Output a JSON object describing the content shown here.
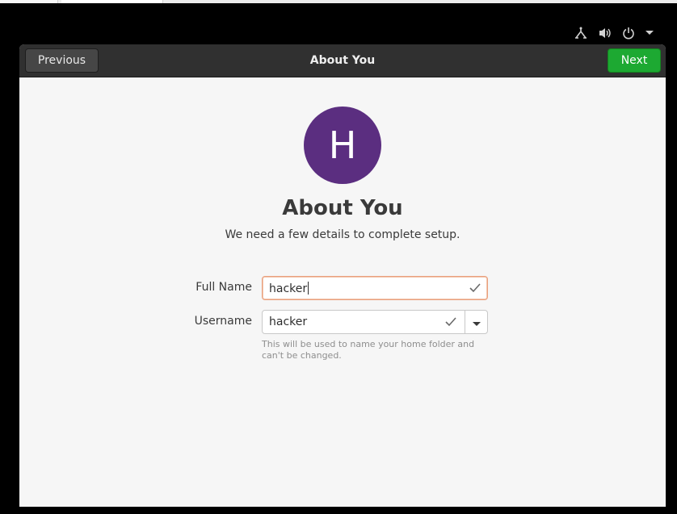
{
  "tray": {
    "icons": [
      "network-icon",
      "volume-icon",
      "power-icon",
      "menu-arrow-icon"
    ]
  },
  "header": {
    "previous_label": "Previous",
    "title": "About You",
    "next_label": "Next"
  },
  "avatar": {
    "initial": "H",
    "color": "#5b2e80"
  },
  "main": {
    "title": "About You",
    "subtitle": "We need a few details to complete setup."
  },
  "form": {
    "full_name": {
      "label": "Full Name",
      "value": "hacker"
    },
    "username": {
      "label": "Username",
      "value": "hacker",
      "hint": "This will be used to name your home folder and can't be changed."
    }
  },
  "colors": {
    "accent_next": "#1da932",
    "focus_border": "#e9a07e"
  }
}
